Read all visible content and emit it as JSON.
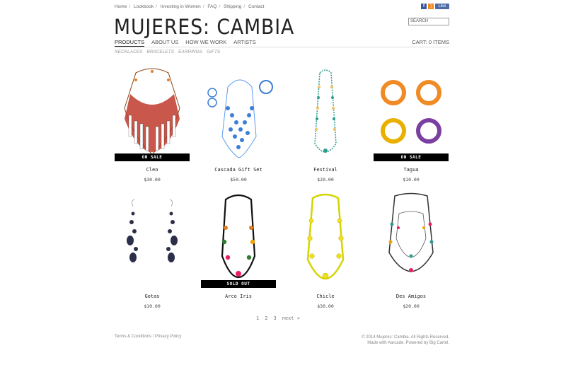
{
  "topnav": [
    "Home",
    "Lookbook",
    "Investing in Women",
    "FAQ",
    "Shipping",
    "Contact"
  ],
  "social": {
    "facebook": "f",
    "rss": ")",
    "like": "Like"
  },
  "brand": {
    "logo": "MUJERES: CAMBIA"
  },
  "search": {
    "placeholder": "SEARCH"
  },
  "mainnav": [
    {
      "label": "PRODUCTS",
      "active": true
    },
    {
      "label": "ABOUT US",
      "active": false
    },
    {
      "label": "HOW WE WORK",
      "active": false
    },
    {
      "label": "ARTISTS",
      "active": false
    }
  ],
  "cart": {
    "label": "CART: 0 ITEMS"
  },
  "subnav": [
    "NECKLACES",
    "BRACELETS",
    "EARRINGS",
    "GIFTS"
  ],
  "products": [
    {
      "name": "Cleo",
      "price": "$30.00",
      "badge": "ON SALE",
      "colors": [
        "#c0392b",
        "#e67e22",
        "#ffffff"
      ]
    },
    {
      "name": "Cascada Gift Set",
      "price": "$50.00",
      "badge": "",
      "colors": [
        "#3b7dd8",
        "#5b9bf0"
      ]
    },
    {
      "name": "Festival",
      "price": "$20.00",
      "badge": "",
      "colors": [
        "#2a9d8f",
        "#e9c46a"
      ]
    },
    {
      "name": "Tagua",
      "price": "$10.00",
      "badge": "ON SALE",
      "colors": [
        "#f08a24",
        "#e9b000",
        "#7b3fa0"
      ]
    },
    {
      "name": "Gotas",
      "price": "$10.00",
      "badge": "",
      "colors": [
        "#2c2f4a",
        "#1a1c33"
      ]
    },
    {
      "name": "Arco Iris",
      "price": "",
      "badge": "SOLD OUT",
      "colors": [
        "#e67e22",
        "#2e7d32",
        "#e91e63"
      ]
    },
    {
      "name": "Chicle",
      "price": "$30.00",
      "badge": "",
      "colors": [
        "#d4d400",
        "#f0e020"
      ]
    },
    {
      "name": "Des Amigos",
      "price": "$20.00",
      "badge": "",
      "colors": [
        "#2a9d8f",
        "#e91e63",
        "#f4a300"
      ]
    }
  ],
  "pagination": [
    "1",
    "2",
    "3",
    "next »"
  ],
  "footer": {
    "links": [
      "Terms & Conditions",
      "Privacy Policy"
    ],
    "copyright": "© 2014 Mujeres: Cambia. All Rights Reserved.",
    "credits": "Made with Aarcade. Powered by Big Cartel."
  }
}
